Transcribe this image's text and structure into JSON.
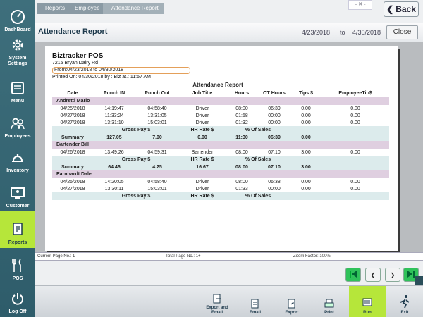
{
  "sidebar": {
    "items": [
      {
        "label": "DashBoard",
        "icon": "dashboard-icon"
      },
      {
        "label": "System Settings",
        "icon": "gear-icon"
      },
      {
        "label": "Menu",
        "icon": "menu-book-icon"
      },
      {
        "label": "Employees",
        "icon": "people-icon"
      },
      {
        "label": "Inventory",
        "icon": "cloche-icon"
      },
      {
        "label": "Customer",
        "icon": "customer-screen-icon"
      },
      {
        "label": "Reports",
        "icon": "reports-icon",
        "active": true
      },
      {
        "label": "POS",
        "icon": "utensils-icon"
      },
      {
        "label": "Log Off",
        "icon": "power-icon"
      }
    ]
  },
  "breadcrumb": [
    "Reports",
    "Employee",
    "Attendance Report"
  ],
  "back_label": "Back",
  "header": {
    "title": "Attendance Report",
    "date_from": "4/23/2018",
    "to_label": "to",
    "date_to": "4/30/2018",
    "close_label": "Close"
  },
  "report": {
    "company": "Biztracker POS",
    "address": "7215 Bryan Dairy Rd",
    "from_line": "From:04/23/2018 to 04/30/2018",
    "printed_line": "Printed On: 04/30/2018 by : Biz  at.: 11:57 AM",
    "title": "Attendance Report",
    "columns": [
      "Date",
      "Punch IN",
      "Punch Out",
      "Job Title",
      "Hours",
      "OT Hours",
      "Tips $",
      "EmployeeTip$"
    ],
    "summary_headers": [
      "Gross Pay $",
      "HR Rate $",
      "% Of Sales"
    ],
    "summary_label": "Summary",
    "groups": [
      {
        "name": "Andretti Mario",
        "rows": [
          [
            "04/25/2018",
            "14:19:47",
            "04:58:40",
            "Driver",
            "08:00",
            "06:39",
            "0.00",
            "0.00"
          ],
          [
            "04/27/2018",
            "11:33:24",
            "13:31:05",
            "Driver",
            "01:58",
            "00:00",
            "0.00",
            "0.00"
          ],
          [
            "04/27/2018",
            "13:31:10",
            "15:03:01",
            "Driver",
            "01:32",
            "00:00",
            "0.00",
            "0.00"
          ]
        ],
        "summary": {
          "gross": "127.05",
          "rate": "7.00",
          "pct": "0.00",
          "hours": "11:30",
          "ot": "06:39",
          "tips": "0.00"
        }
      },
      {
        "name": "Bartender Bill",
        "rows": [
          [
            "04/26/2018",
            "13:49:26",
            "04:59:31",
            "Bartender",
            "08:00",
            "07:10",
            "3.00",
            "0.00"
          ]
        ],
        "summary": {
          "gross": "64.46",
          "rate": "4.25",
          "pct": "16.67",
          "hours": "08:00",
          "ot": "07:10",
          "tips": "3.00"
        }
      },
      {
        "name": "Earnhardt Dale",
        "rows": [
          [
            "04/25/2018",
            "14:20:05",
            "04:58:40",
            "Driver",
            "08:00",
            "06:38",
            "0.00",
            "0.00"
          ],
          [
            "04/27/2018",
            "13:30:11",
            "15:03:01",
            "Driver",
            "01:33",
            "00:00",
            "0.00",
            "0.00"
          ]
        ],
        "summary": null
      }
    ]
  },
  "statusbar": {
    "current_page": "Current Page No.: 1",
    "total_page": "Total Page No.: 1+",
    "zoom": "Zoom Factor: 100%"
  },
  "bottom": {
    "export_email": "Export and Email",
    "email": "Email",
    "export": "Export",
    "print": "Print",
    "run": "Run",
    "exit": "Exit"
  },
  "colors": {
    "sidebar": "#2e5c6a",
    "accent": "#b6e63a",
    "group_row": "#dfcfe0",
    "summary_row": "#dcebec",
    "pager_green": "#2fc25a"
  }
}
